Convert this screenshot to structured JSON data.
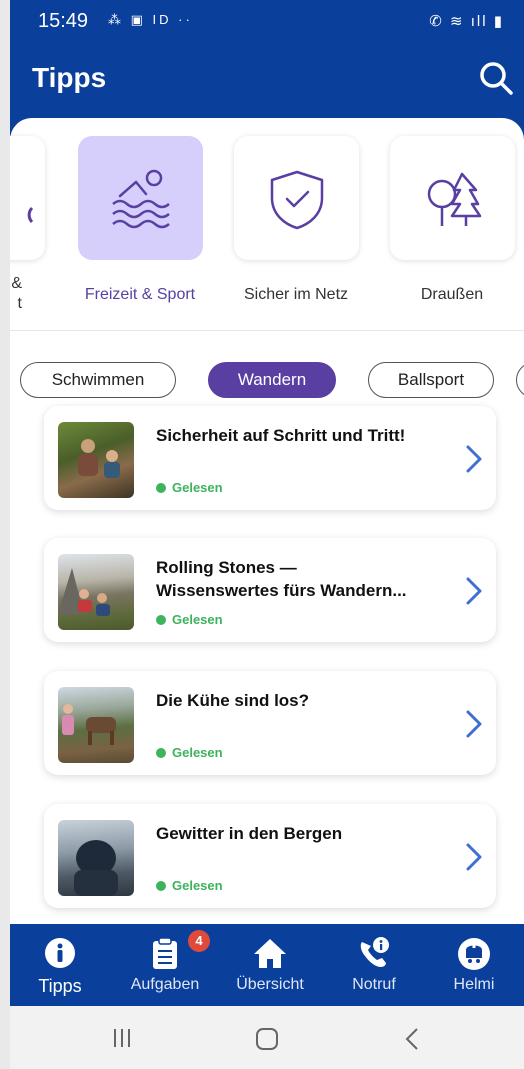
{
  "status_bar": {
    "time": "15:49",
    "left_icons": "⁂ ▣ ID ··",
    "right_icons": "✆ ≋ ıll ▮"
  },
  "header": {
    "title": "Tipps"
  },
  "categories": [
    {
      "label": "&\nt",
      "icon": "partial-icon"
    },
    {
      "label": "Freizeit & Sport",
      "icon": "swimming-icon",
      "selected": true
    },
    {
      "label": "Sicher im Netz",
      "icon": "shield-check-icon"
    },
    {
      "label": "Draußen",
      "icon": "trees-icon"
    }
  ],
  "filters": [
    {
      "label": "Schwimmen"
    },
    {
      "label": "Wandern",
      "active": true
    },
    {
      "label": "Ballsport"
    }
  ],
  "articles": [
    {
      "title": "Sicherheit auf Schritt und Tritt!",
      "status": "Gelesen"
    },
    {
      "title": "Rolling Stones —\nWissenswertes fürs Wandern...",
      "status": "Gelesen"
    },
    {
      "title": "Die Kühe sind los?",
      "status": "Gelesen"
    },
    {
      "title": "Gewitter in den Bergen",
      "status": "Gelesen"
    }
  ],
  "bottom_nav": [
    {
      "label": "Tipps",
      "icon": "info-icon",
      "active": true
    },
    {
      "label": "Aufgaben",
      "icon": "clipboard-icon",
      "badge": "4"
    },
    {
      "label": "Übersicht",
      "icon": "home-icon"
    },
    {
      "label": "Notruf",
      "icon": "phone-info-icon"
    },
    {
      "label": "Helmi",
      "icon": "helmi-icon"
    }
  ],
  "colors": {
    "primary": "#0a3f9b",
    "accent": "#5a3fa3",
    "selected_tile": "#d6cffc",
    "read_status": "#3cb35c",
    "icon_purple": "#5a3fa3"
  }
}
